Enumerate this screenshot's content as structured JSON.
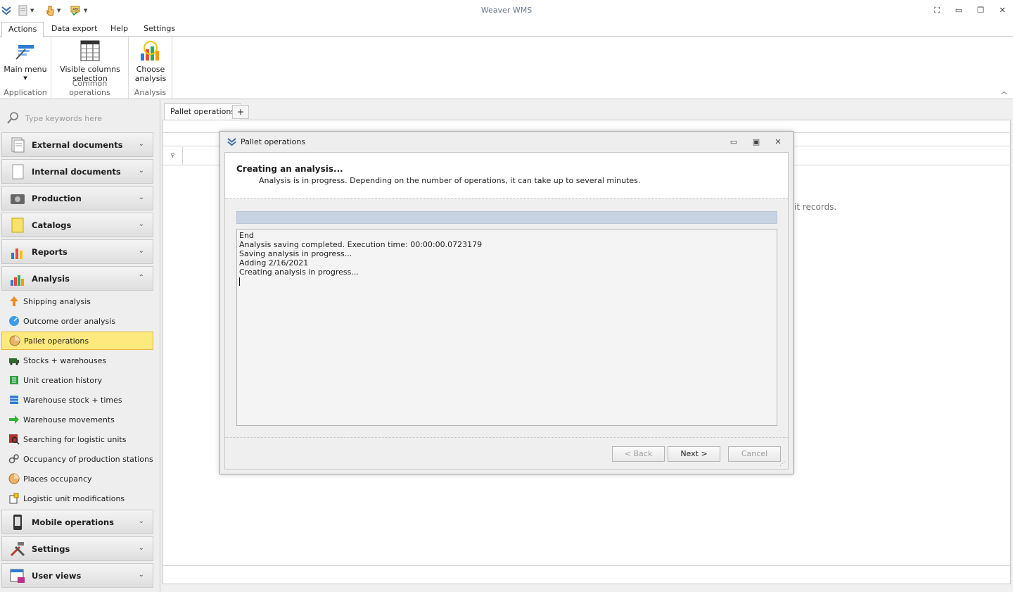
{
  "app": {
    "title": "Weaver WMS"
  },
  "ribbon": {
    "tabs": [
      {
        "label": "Actions",
        "active": true
      },
      {
        "label": "Data export"
      },
      {
        "label": "Help"
      },
      {
        "label": "Settings"
      }
    ],
    "groups": [
      {
        "label": "Application",
        "buttons": [
          {
            "label": "Main menu"
          }
        ]
      },
      {
        "label": "Common operations",
        "buttons": [
          {
            "label_line1": "Visible columns",
            "label_line2": "selection"
          }
        ]
      },
      {
        "label": "Analysis",
        "buttons": [
          {
            "label_line1": "Choose",
            "label_line2": "analysis"
          }
        ]
      }
    ]
  },
  "nav": {
    "search_placeholder": "Type keywords here",
    "groups_top": [
      {
        "label": "External documents"
      },
      {
        "label": "Internal documents"
      },
      {
        "label": "Production"
      },
      {
        "label": "Catalogs"
      },
      {
        "label": "Reports"
      },
      {
        "label": "Analysis",
        "expanded": true
      }
    ],
    "analysis_items": [
      {
        "label": "Shipping analysis"
      },
      {
        "label": "Outcome order analysis"
      },
      {
        "label": "Pallet operations",
        "selected": true
      },
      {
        "label": "Stocks + warehouses"
      },
      {
        "label": "Unit creation history"
      },
      {
        "label": "Warehouse stock + times"
      },
      {
        "label": "Warehouse movements"
      },
      {
        "label": "Searching for logistic units"
      },
      {
        "label": "Occupancy of production stations"
      },
      {
        "label": "Places occupancy"
      },
      {
        "label": "Logistic unit modifications"
      }
    ],
    "groups_bottom": [
      {
        "label": "Mobile operations"
      },
      {
        "label": "Settings"
      },
      {
        "label": "User views"
      }
    ]
  },
  "main": {
    "tab_label": "Pallet operations",
    "add_tab": "+",
    "no_data_text": "it records."
  },
  "dialog": {
    "title": "Pallet operations",
    "heading": "Creating an analysis...",
    "subheading": "Analysis is in progress. Depending on the number of operations, it can take up to several minutes.",
    "log_lines": [
      "End",
      "Analysis saving completed. Execution time: 00:00:00.0723179",
      "Saving analysis in progress...",
      "Adding 2/16/2021",
      "Creating analysis in progress..."
    ],
    "buttons": {
      "back": "< Back",
      "next": "Next >",
      "cancel": "Cancel"
    }
  },
  "colors": {
    "selected_item": "#fde97e",
    "accent": "#3a6ea5"
  }
}
